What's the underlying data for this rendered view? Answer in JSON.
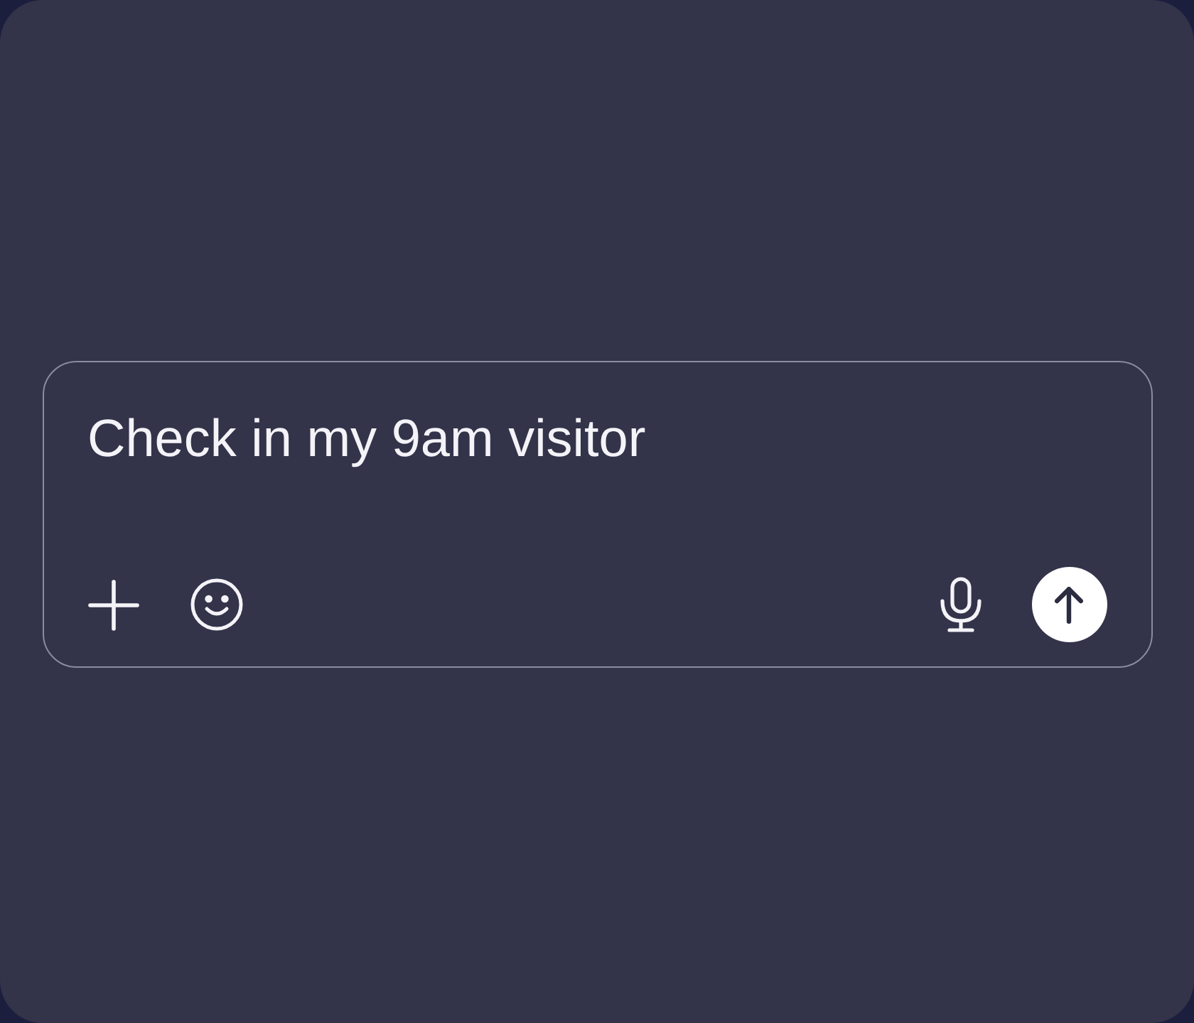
{
  "composer": {
    "value": "Check in my 9am visitor"
  }
}
